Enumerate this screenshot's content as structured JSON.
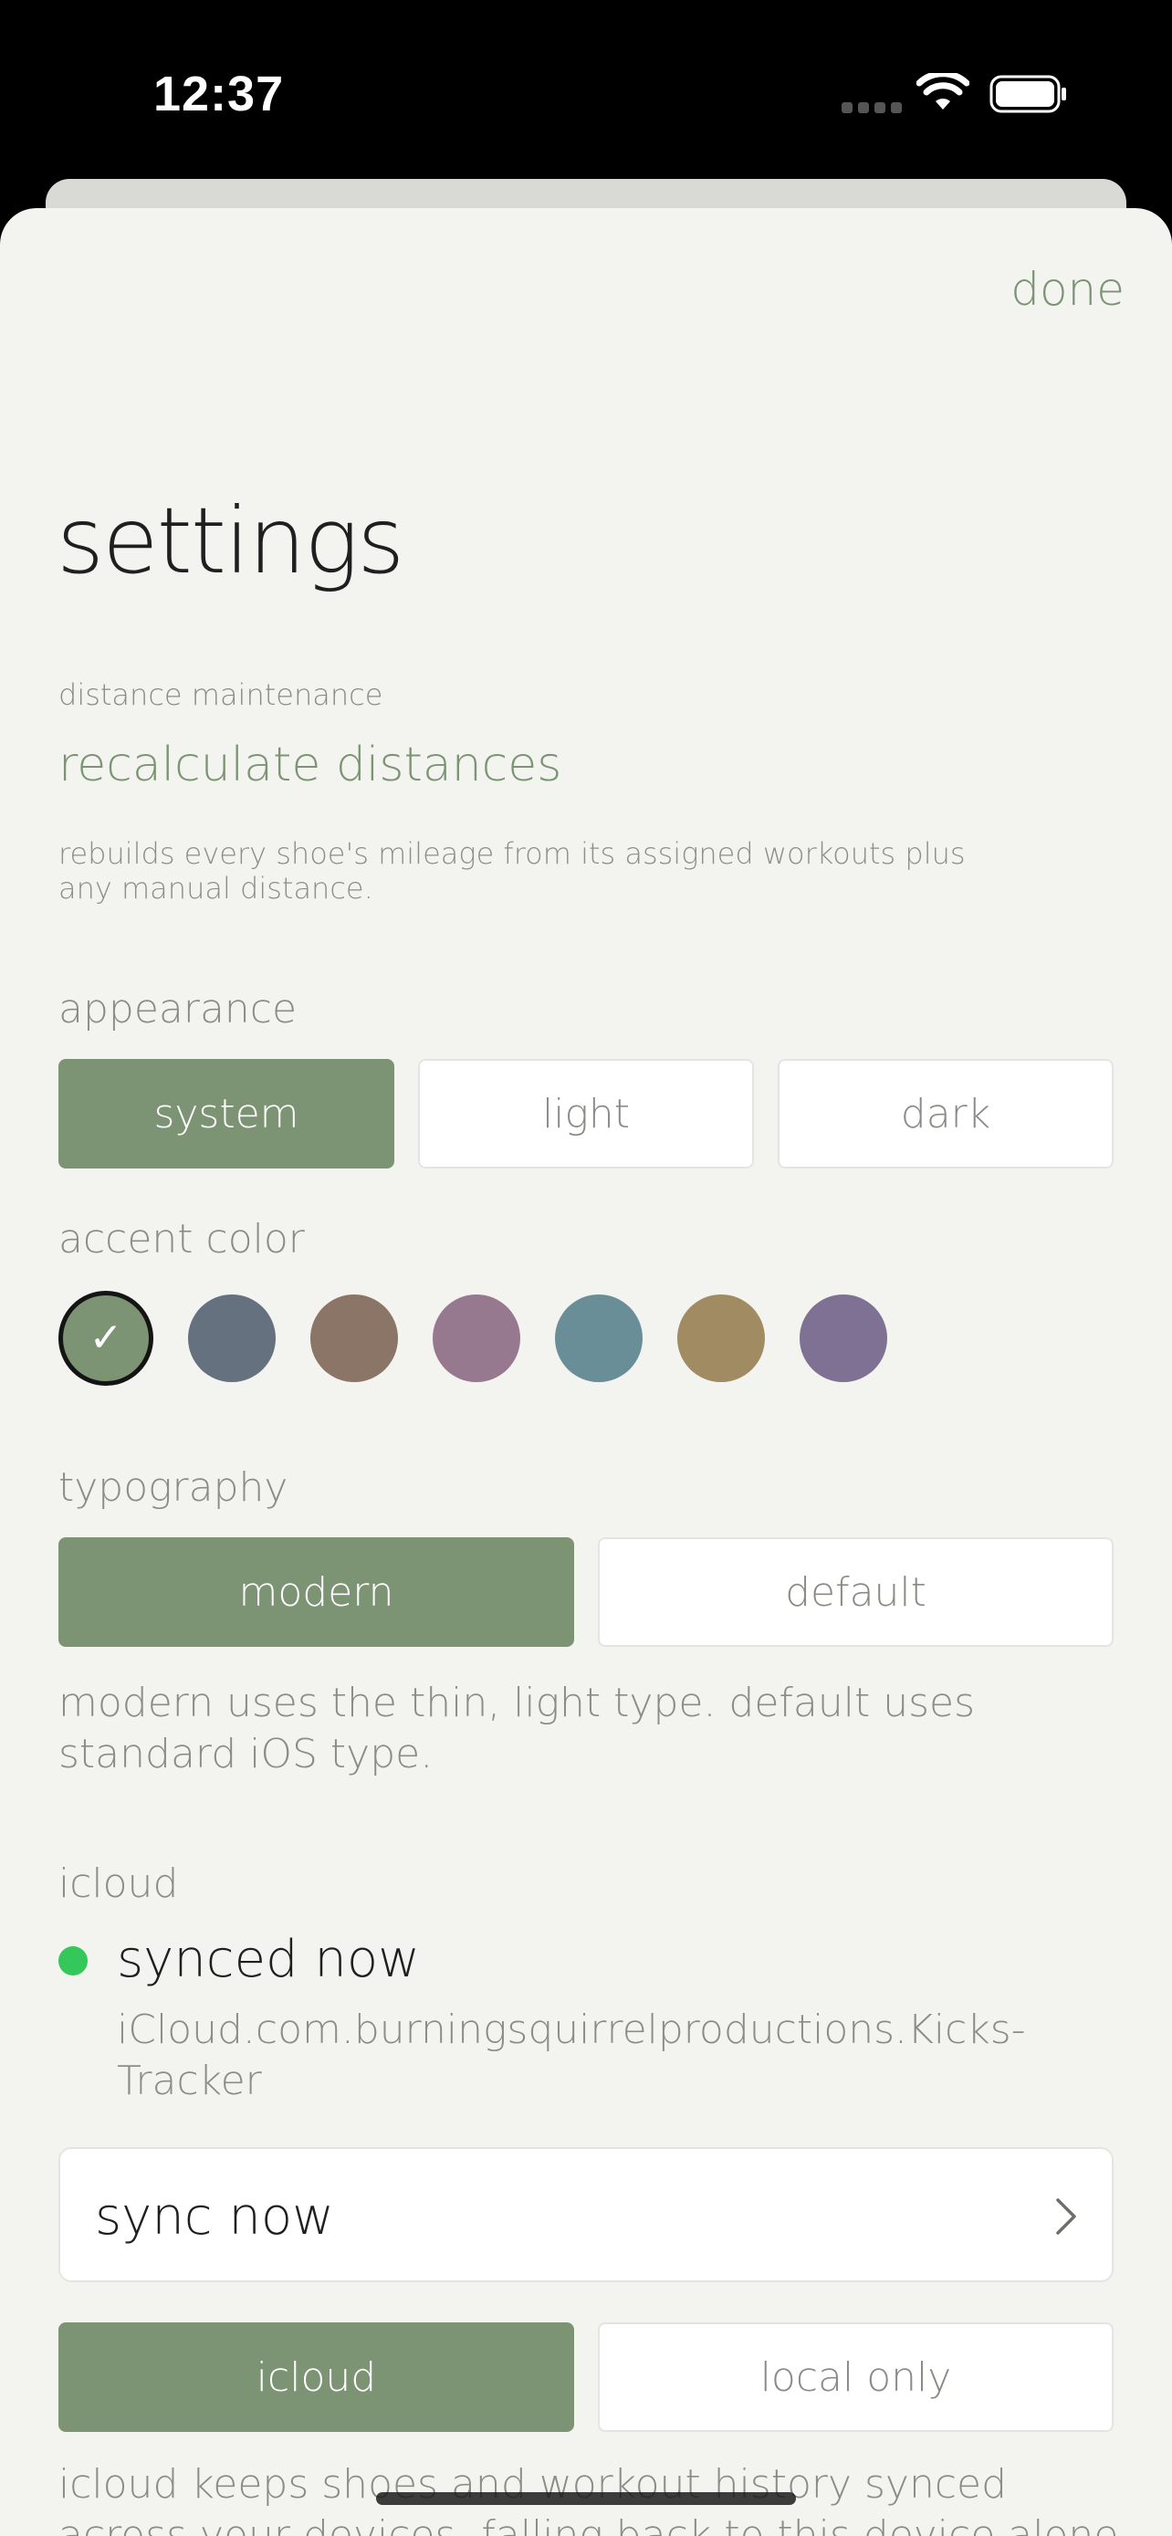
{
  "status_bar": {
    "time": "12:37"
  },
  "header": {
    "done_label": "done",
    "title": "settings"
  },
  "distance": {
    "caption": "distance maintenance",
    "action_label": "recalculate distances",
    "help": "rebuilds every shoe's mileage from its assigned workouts plus any manual distance."
  },
  "appearance": {
    "label": "appearance",
    "options": [
      "system",
      "light",
      "dark"
    ],
    "selected": "system"
  },
  "accent": {
    "label": "accent color",
    "colors": [
      "#7d9474",
      "#667180",
      "#8b7566",
      "#96798e",
      "#6a8e98",
      "#a08b62",
      "#7f7193"
    ],
    "selected_index": 0,
    "check_glyph": "✓"
  },
  "typography": {
    "label": "typography",
    "options": [
      "modern",
      "default"
    ],
    "selected": "modern",
    "help": "modern uses the thin, light type. default uses standard iOS type."
  },
  "icloud": {
    "label": "icloud",
    "status": "synced now",
    "status_color": "#34c759",
    "container": "iCloud.com.burningsquirrelproductions.Kicks-Tracker",
    "sync_button_label": "sync now",
    "mode_options": [
      "icloud",
      "local only"
    ],
    "mode_selected": "icloud",
    "help": "icloud keeps shoes and workout history synced across your devices, falling back to this device alone if icloud"
  },
  "theme": {
    "accent": "#7d9474",
    "background": "#f3f3ef"
  }
}
